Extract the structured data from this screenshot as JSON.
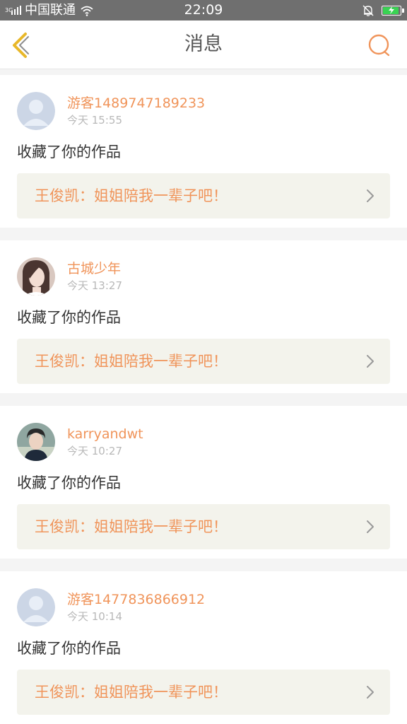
{
  "status_bar": {
    "network": "3G",
    "carrier": "中国联通",
    "time": "22:09"
  },
  "nav": {
    "title": "消息",
    "back_icon": "chevron-left-icon",
    "search_icon": "search-icon"
  },
  "colors": {
    "accent": "#f0945a",
    "back_icon": "#e8b82a",
    "card_link_bg": "#f3f3ec",
    "battery": "#39d353"
  },
  "messages": [
    {
      "username": "游客1489747189233",
      "time": "今天 15:55",
      "action": "收藏了你的作品",
      "work_title": "王俊凯：姐姐陪我一辈子吧！",
      "avatar": "default-avatar"
    },
    {
      "username": "古城少年",
      "time": "今天 13:27",
      "action": "收藏了你的作品",
      "work_title": "王俊凯：姐姐陪我一辈子吧！",
      "avatar": "photo-avatar-girl"
    },
    {
      "username": "karryandwt",
      "time": "今天 10:27",
      "action": "收藏了你的作品",
      "work_title": "王俊凯：姐姐陪我一辈子吧！",
      "avatar": "photo-avatar-boy"
    },
    {
      "username": "游客1477836866912",
      "time": "今天 10:14",
      "action": "收藏了你的作品",
      "work_title": "王俊凯：姐姐陪我一辈子吧！",
      "avatar": "default-avatar"
    }
  ]
}
